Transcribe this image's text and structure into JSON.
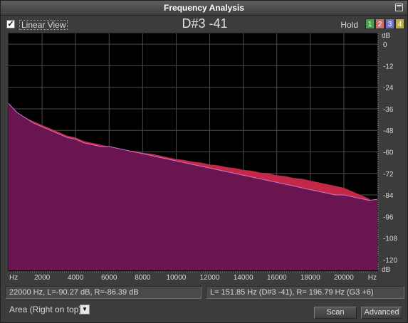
{
  "window": {
    "title": "Frequency Analysis"
  },
  "toolbar": {
    "linear_view_label": "Linear View",
    "linear_view_checked": true,
    "note_readout": "D#3 -41",
    "hold_label": "Hold",
    "hold_buttons": [
      {
        "label": "1",
        "color": "#49a04a"
      },
      {
        "label": "2",
        "color": "#c86c6c"
      },
      {
        "label": "3",
        "color": "#6e72c8"
      },
      {
        "label": "4",
        "color": "#b8b044"
      }
    ]
  },
  "chart_data": {
    "type": "area",
    "title": "",
    "xlabel": "Hz",
    "ylabel": "dB",
    "x_scale": "linear",
    "xlim": [
      0,
      22000
    ],
    "ylim": [
      -126,
      6
    ],
    "x_ticks": [
      {
        "value": 2000,
        "label": "2000"
      },
      {
        "value": 4000,
        "label": "4000"
      },
      {
        "value": 6000,
        "label": "6000"
      },
      {
        "value": 8000,
        "label": "8000"
      },
      {
        "value": 10000,
        "label": "10000"
      },
      {
        "value": 12000,
        "label": "12000"
      },
      {
        "value": 14000,
        "label": "14000"
      },
      {
        "value": 16000,
        "label": "16000"
      },
      {
        "value": 18000,
        "label": "18000"
      },
      {
        "value": 20000,
        "label": "20000"
      }
    ],
    "x_unit_labels": [
      "Hz",
      "Hz"
    ],
    "y_ticks": [
      {
        "value": 0,
        "label": "0"
      },
      {
        "value": -12,
        "label": "-12"
      },
      {
        "value": -24,
        "label": "-24"
      },
      {
        "value": -36,
        "label": "-36"
      },
      {
        "value": -48,
        "label": "-48"
      },
      {
        "value": -60,
        "label": "-60"
      },
      {
        "value": -72,
        "label": "-72"
      },
      {
        "value": -84,
        "label": "-84"
      },
      {
        "value": -96,
        "label": "-96"
      },
      {
        "value": -108,
        "label": "-108"
      },
      {
        "value": -120,
        "label": "-120"
      }
    ],
    "y_unit_labels": [
      "dB",
      "dB"
    ],
    "grid": true,
    "view_mode": "Area (Right on top)",
    "colors": {
      "left": "#c42848",
      "right": "#6a1450",
      "right_outline": "#c878c8",
      "background": "#000000",
      "grid": "#4a4a4a"
    },
    "series": [
      {
        "channel": "L",
        "x": [
          0,
          500,
          1000,
          1500,
          2000,
          2500,
          3000,
          3500,
          4000,
          4500,
          5000,
          5500,
          6000,
          6500,
          7000,
          7500,
          8000,
          8500,
          9000,
          9500,
          10000,
          10500,
          11000,
          11500,
          12000,
          12500,
          13000,
          13500,
          14000,
          14500,
          15000,
          15500,
          16000,
          16500,
          17000,
          17500,
          18000,
          18500,
          19000,
          19500,
          20000,
          20500,
          21000,
          21500,
          22000
        ],
        "values": [
          -34,
          -38,
          -41,
          -43,
          -45,
          -47,
          -49,
          -51,
          -52,
          -54,
          -55,
          -56,
          -57,
          -58,
          -59,
          -59.5,
          -60.5,
          -61,
          -62,
          -63,
          -64,
          -64.5,
          -65.5,
          -66,
          -67,
          -67.5,
          -68.5,
          -69,
          -70,
          -70.5,
          -71.5,
          -72,
          -73,
          -73.5,
          -74.5,
          -75,
          -76,
          -77,
          -78,
          -79,
          -80,
          -82,
          -84,
          -86,
          -90.27
        ]
      },
      {
        "channel": "R",
        "x": [
          0,
          500,
          1000,
          1500,
          2000,
          2500,
          3000,
          3500,
          4000,
          4500,
          5000,
          5500,
          6000,
          6500,
          7000,
          7500,
          8000,
          8500,
          9000,
          9500,
          10000,
          10500,
          11000,
          11500,
          12000,
          12500,
          13000,
          13500,
          14000,
          14500,
          15000,
          15500,
          16000,
          16500,
          17000,
          17500,
          18000,
          18500,
          19000,
          19500,
          20000,
          20500,
          21000,
          21500,
          22000
        ],
        "values": [
          -33,
          -38,
          -41,
          -44,
          -46,
          -48,
          -50,
          -52,
          -53,
          -55,
          -56,
          -57,
          -57,
          -58,
          -59,
          -60,
          -61,
          -62,
          -63,
          -64,
          -65,
          -66,
          -67,
          -68,
          -69,
          -70,
          -71,
          -72,
          -73,
          -74,
          -75,
          -76,
          -77,
          -78,
          -79,
          -80,
          -81,
          -82,
          -83,
          -84,
          -84,
          -85,
          -86,
          -87,
          -86.39
        ]
      }
    ]
  },
  "status": {
    "cursor_readout": "22000 Hz, L=-90.27 dB, R=-86.39 dB",
    "peak_readout": "L= 151.85 Hz (D#3 -41), R= 196.79 Hz (G3 +6)"
  },
  "controls": {
    "view_mode_selected": "Area (Right on top)",
    "scan_label": "Scan",
    "advanced_label": "Advanced"
  }
}
